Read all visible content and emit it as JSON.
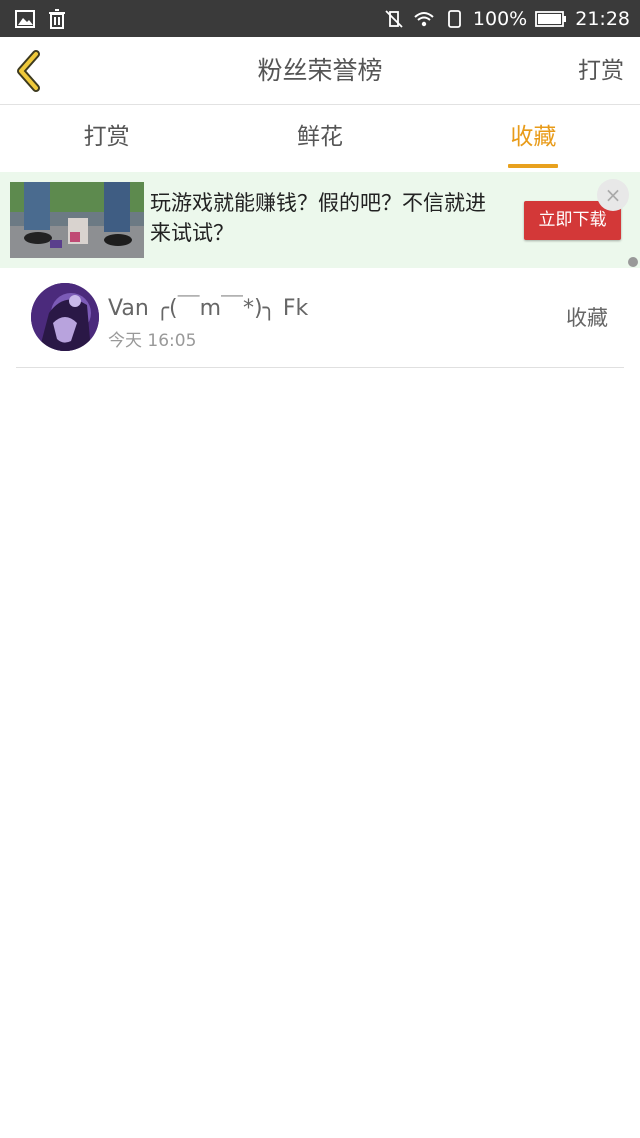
{
  "status_bar": {
    "battery": "100%",
    "time": "21:28"
  },
  "header": {
    "title": "粉丝荣誉榜",
    "right_label": "打赏"
  },
  "tabs": [
    {
      "label": "打赏",
      "active": false
    },
    {
      "label": "鲜花",
      "active": false
    },
    {
      "label": "收藏",
      "active": true
    }
  ],
  "ad": {
    "text": "玩游戏就能赚钱？假的吧？不信就进来试试？",
    "button_label": "立即下载",
    "close_symbol": "×"
  },
  "list": [
    {
      "name": "Van ╭(￣m￣*)╮ Fk",
      "time": "今天 16:05",
      "action": "收藏"
    }
  ],
  "colors": {
    "accent": "#e8a11e",
    "status_bar": "#3a3a3a",
    "ad_background": "#ecf8ec",
    "ad_button": "#d33838"
  }
}
